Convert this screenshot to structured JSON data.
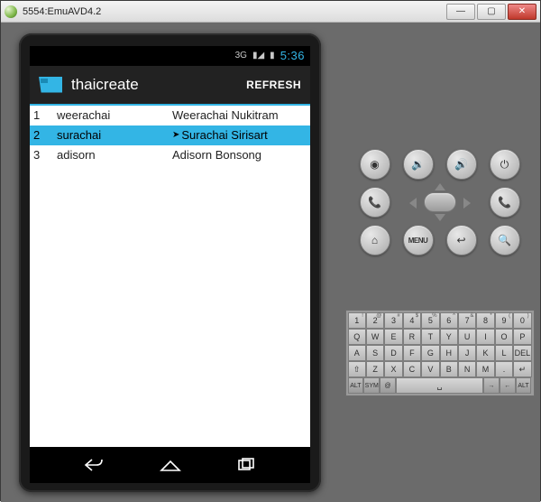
{
  "window": {
    "title": "5554:EmuAVD4.2"
  },
  "statusbar": {
    "network": "3G",
    "time": "5:36"
  },
  "appbar": {
    "title": "thaicreate",
    "refresh": "REFRESH"
  },
  "list": {
    "rows": [
      {
        "id": "1",
        "user": "weerachai",
        "name": "Weerachai Nukitram",
        "selected": false
      },
      {
        "id": "2",
        "user": "surachai",
        "name": "Surachai Sirisart",
        "selected": true
      },
      {
        "id": "3",
        "user": "adisorn",
        "name": "Adisorn Bonsong",
        "selected": false
      }
    ]
  },
  "hw": {
    "camera": "◉",
    "vol_down": "🔉",
    "vol_up": "🔊",
    "power": "⏻",
    "call": "📞",
    "end": "📞",
    "home": "⌂",
    "menu": "MENU",
    "back": "↩",
    "search": "🔍"
  },
  "keyboard": {
    "r1": [
      {
        "m": "1",
        "s": "!"
      },
      {
        "m": "2",
        "s": "@"
      },
      {
        "m": "3",
        "s": "#"
      },
      {
        "m": "4",
        "s": "$"
      },
      {
        "m": "5",
        "s": "%"
      },
      {
        "m": "6",
        "s": "^"
      },
      {
        "m": "7",
        "s": "&"
      },
      {
        "m": "8",
        "s": "*"
      },
      {
        "m": "9",
        "s": "("
      },
      {
        "m": "0",
        "s": ")"
      }
    ],
    "r2": [
      {
        "m": "Q"
      },
      {
        "m": "W"
      },
      {
        "m": "E"
      },
      {
        "m": "R"
      },
      {
        "m": "T"
      },
      {
        "m": "Y"
      },
      {
        "m": "U"
      },
      {
        "m": "I"
      },
      {
        "m": "O"
      },
      {
        "m": "P"
      }
    ],
    "r3": [
      {
        "m": "A"
      },
      {
        "m": "S"
      },
      {
        "m": "D"
      },
      {
        "m": "F"
      },
      {
        "m": "G"
      },
      {
        "m": "H"
      },
      {
        "m": "J"
      },
      {
        "m": "K"
      },
      {
        "m": "L"
      },
      {
        "m": "DEL",
        "s": ""
      }
    ],
    "r4": [
      {
        "m": "⇧"
      },
      {
        "m": "Z"
      },
      {
        "m": "X"
      },
      {
        "m": "C"
      },
      {
        "m": "V"
      },
      {
        "m": "B"
      },
      {
        "m": "N"
      },
      {
        "m": "M"
      },
      {
        "m": "."
      },
      {
        "m": "↵"
      }
    ],
    "r5_left": [
      {
        "m": "ALT"
      },
      {
        "m": "SYM"
      },
      {
        "m": "@"
      }
    ],
    "r5_space": {
      "m": "␣"
    },
    "r5_right": [
      {
        "m": "→"
      },
      {
        "m": "←"
      },
      {
        "m": "ALT"
      }
    ]
  }
}
